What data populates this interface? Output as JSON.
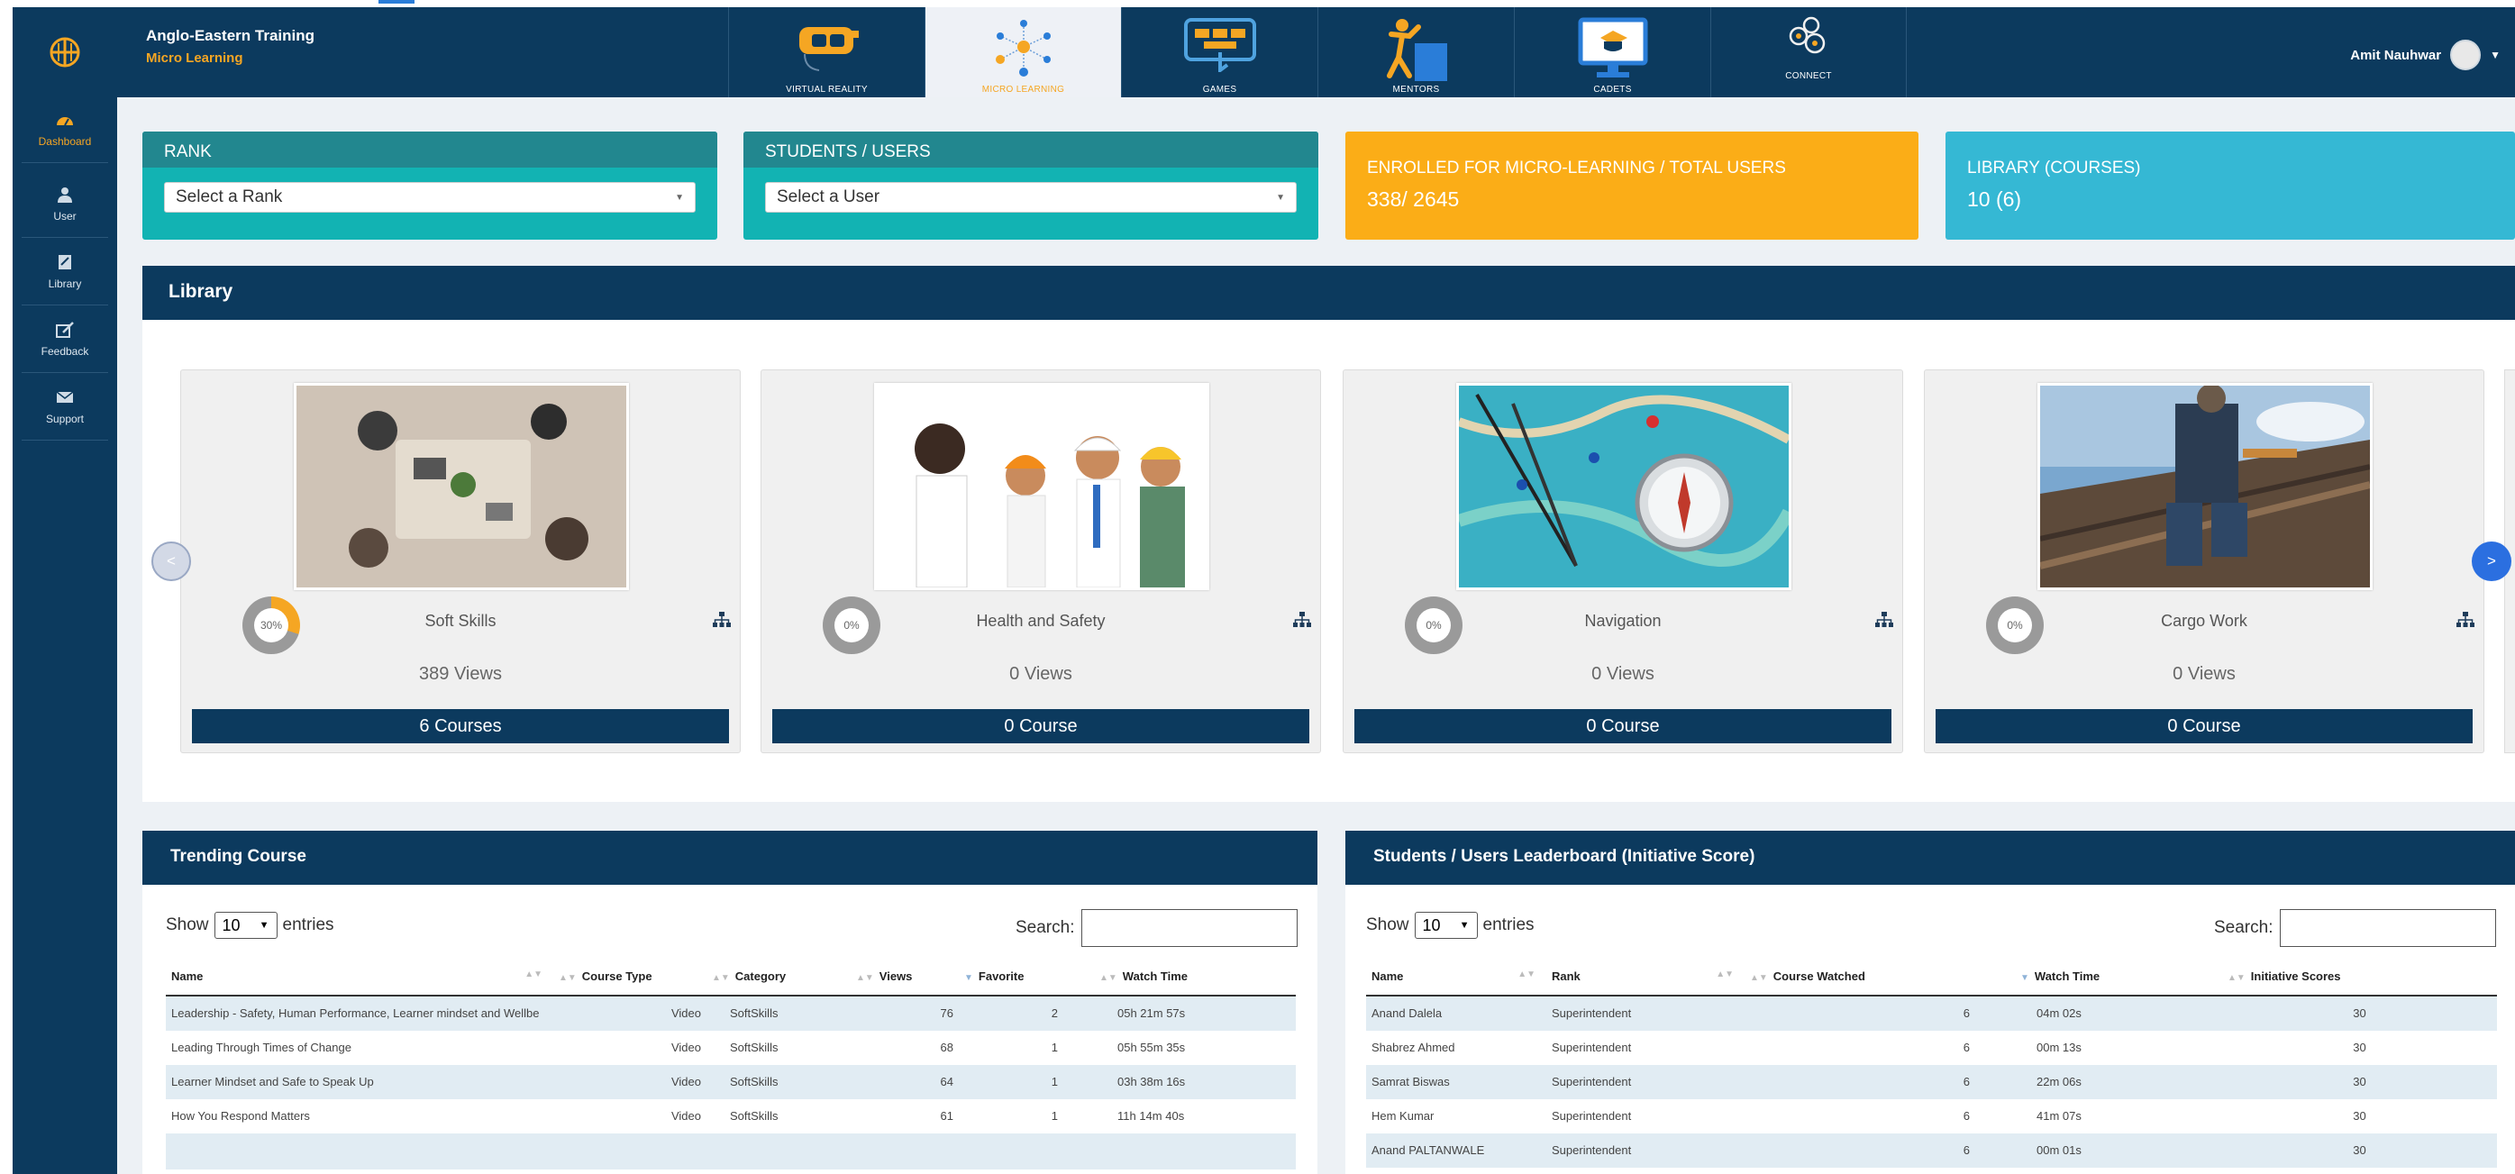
{
  "app": {
    "line1": "Anglo-Eastern Training",
    "line2": "Micro Learning"
  },
  "colors": {
    "navy": "#0c3a5e",
    "accent": "#f5a623",
    "teal": "#12b3b3",
    "orange": "#fbad17",
    "cyan": "#35b8d4"
  },
  "sidebar": {
    "items": [
      {
        "label": "Dashboard",
        "icon": "dashboard-gauge-icon"
      },
      {
        "label": "User",
        "icon": "user-icon"
      },
      {
        "label": "Library",
        "icon": "book-icon"
      },
      {
        "label": "Feedback",
        "icon": "feedback-icon"
      },
      {
        "label": "Support",
        "icon": "envelope-icon"
      }
    ]
  },
  "nav": {
    "tabs": [
      {
        "label": "VIRTUAL REALITY",
        "icon": "vr-headset-icon"
      },
      {
        "label": "MICRO LEARNING",
        "icon": "network-nodes-icon"
      },
      {
        "label": "GAMES",
        "icon": "game-board-icon"
      },
      {
        "label": "MENTORS",
        "icon": "mentor-icon"
      },
      {
        "label": "CADETS",
        "icon": "monitor-icon"
      },
      {
        "label": "CONNECT",
        "icon": "gears-icon"
      }
    ],
    "active": "MICRO LEARNING"
  },
  "user": {
    "name": "Amit Nauhwar"
  },
  "stats": {
    "rank": {
      "title": "RANK",
      "placeholder": "Select a Rank"
    },
    "students": {
      "title": "STUDENTS / USERS",
      "placeholder": "Select a User"
    },
    "enrolled": {
      "title": "ENROLLED FOR MICRO-LEARNING / TOTAL USERS",
      "value": "338/ 2645"
    },
    "library": {
      "title": "LIBRARY (COURSES)",
      "value": "10 (6)"
    }
  },
  "library": {
    "title": "Library",
    "prev": "<",
    "next": ">",
    "cards": [
      {
        "title": "Soft Skills",
        "percent_label": "30%",
        "percent": 30,
        "views": "389 Views",
        "courses": "6 Courses"
      },
      {
        "title": "Health and Safety",
        "percent_label": "0%",
        "percent": 0,
        "views": "0 Views",
        "courses": "0 Course"
      },
      {
        "title": "Navigation",
        "percent_label": "0%",
        "percent": 0,
        "views": "0 Views",
        "courses": "0 Course"
      },
      {
        "title": "Cargo Work",
        "percent_label": "0%",
        "percent": 0,
        "views": "0 Views",
        "courses": "0 Course"
      }
    ]
  },
  "trending": {
    "title": "Trending Course",
    "show_label": "Show",
    "entries_value": "10",
    "entries_label": "entries",
    "search_label": "Search:",
    "columns": [
      "Name",
      "Course Type",
      "Category",
      "Views",
      "Favorite",
      "Watch Time"
    ],
    "rows": [
      [
        "Leadership - Safety, Human Performance, Learner mindset and Wellbe",
        "Video",
        "SoftSkills",
        "76",
        "2",
        "05h 21m 57s"
      ],
      [
        "Leading Through Times of Change",
        "Video",
        "SoftSkills",
        "68",
        "1",
        "05h 55m 35s"
      ],
      [
        "Learner Mindset and Safe to Speak Up",
        "Video",
        "SoftSkills",
        "64",
        "1",
        "03h 38m 16s"
      ],
      [
        "How You Respond Matters",
        "Video",
        "SoftSkills",
        "61",
        "1",
        "11h 14m 40s"
      ]
    ]
  },
  "leaderboard": {
    "title": "Students / Users Leaderboard (Initiative Score)",
    "show_label": "Show",
    "entries_value": "10",
    "entries_label": "entries",
    "search_label": "Search:",
    "columns": [
      "Name",
      "Rank",
      "Course Watched",
      "Watch Time",
      "Initiative Scores"
    ],
    "rows": [
      [
        "Anand Dalela",
        "Superintendent",
        "6",
        "04m 02s",
        "30"
      ],
      [
        "Shabrez Ahmed",
        "Superintendent",
        "6",
        "00m 13s",
        "30"
      ],
      [
        "Samrat Biswas",
        "Superintendent",
        "6",
        "22m 06s",
        "30"
      ],
      [
        "Hem Kumar",
        "Superintendent",
        "6",
        "41m 07s",
        "30"
      ],
      [
        "Anand PALTANWALE",
        "Superintendent",
        "6",
        "00m 01s",
        "30"
      ]
    ]
  }
}
